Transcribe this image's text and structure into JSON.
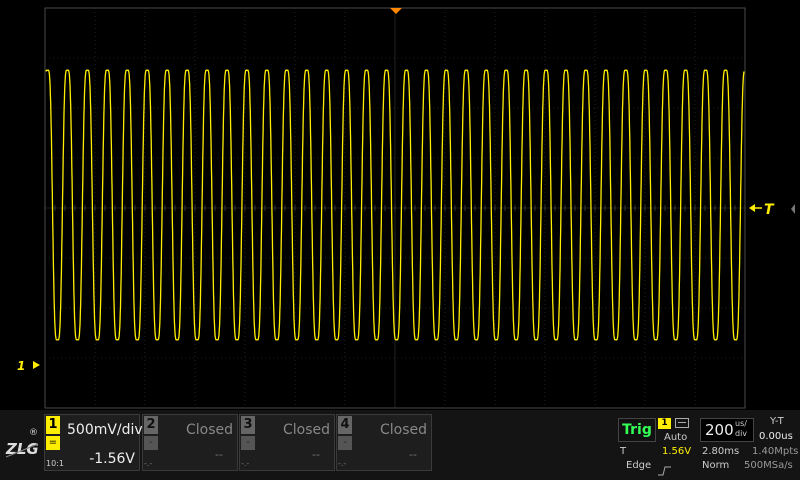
{
  "display": {
    "trace_color": "#ffee00",
    "grid_color": "#3a3a3a",
    "trigger_marker_label": "T",
    "channel_marker_label": "1",
    "waveform": {
      "cycles": 35,
      "high_level": "1.56V",
      "low_level": "-1.56V"
    }
  },
  "logo": {
    "text": "ZLG",
    "registered": "®"
  },
  "channels": [
    {
      "number": "1",
      "coupling": "=",
      "probe": "10:1",
      "scale": "500mV/div",
      "offset": "-1.56V",
      "state": "on"
    },
    {
      "number": "2",
      "coupling": "-",
      "probe": "-.-",
      "status": "Closed",
      "offset": "--",
      "state": "off"
    },
    {
      "number": "3",
      "coupling": "-",
      "probe": "-.-",
      "status": "Closed",
      "offset": "--",
      "state": "off"
    },
    {
      "number": "4",
      "coupling": "-",
      "probe": "-.-",
      "status": "Closed",
      "offset": "--",
      "state": "off"
    }
  ],
  "trigger": {
    "label": "Trig",
    "source": "1",
    "mode": "Auto",
    "type_label": "T",
    "level": "1.56V",
    "edge": "Edge",
    "sweep": "Norm"
  },
  "timebase": {
    "value": "200",
    "unit_top": "us/",
    "unit_bottom": "div",
    "record_time": "2.80ms",
    "memory_depth": "1.40Mpts",
    "sample_rate": "500MSa/s",
    "display_mode": "Y-T",
    "delay": "0.00us"
  }
}
